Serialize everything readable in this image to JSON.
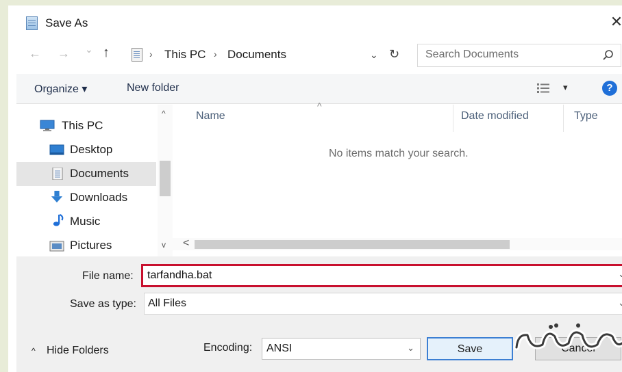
{
  "window": {
    "title": "Save As",
    "close_glyph": "✕"
  },
  "nav": {
    "back_glyph": "←",
    "forward_glyph": "→",
    "recent_glyph": "⌄",
    "up_glyph": "↑",
    "breadcrumb": [
      "This PC",
      "Documents"
    ],
    "breadcrumb_sep": "›",
    "dropdown_glyph": "⌄",
    "refresh_glyph": "↻",
    "search_placeholder": "Search Documents"
  },
  "toolbar": {
    "organize_label": "Organize ▾",
    "new_folder_label": "New folder",
    "view_dropdown_glyph": "▾",
    "help_label": "?"
  },
  "sidebar": {
    "items": [
      {
        "label": "This PC",
        "icon": "monitor-icon"
      },
      {
        "label": "Desktop",
        "icon": "desktop-icon"
      },
      {
        "label": "Documents",
        "icon": "documents-icon",
        "selected": true
      },
      {
        "label": "Downloads",
        "icon": "download-arrow-icon"
      },
      {
        "label": "Music",
        "icon": "music-note-icon"
      },
      {
        "label": "Pictures",
        "icon": "pictures-icon"
      }
    ],
    "scroll_up_glyph": "^",
    "scroll_down_glyph": "v"
  },
  "content": {
    "columns": [
      "Name",
      "Date modified",
      "Type"
    ],
    "sort_glyph": "^",
    "empty_message": "No items match your search.",
    "hscroll_left_glyph": "<",
    "hscroll_right_glyph": ">"
  },
  "form": {
    "file_name_label": "File name:",
    "file_name_value": "tarfandha.bat",
    "save_as_type_label": "Save as type:",
    "save_as_type_value": "All Files",
    "encoding_label": "Encoding:",
    "encoding_value": "ANSI",
    "dropdown_glyph": "⌄",
    "hide_folders_label": "Hide Folders",
    "hide_folders_glyph": "^",
    "save_label": "Save",
    "cancel_label": "Cancel"
  },
  "colors": {
    "highlight_border": "#c8102e",
    "accent": "#1f6fd8",
    "selected_bg": "#e5e5e5"
  }
}
